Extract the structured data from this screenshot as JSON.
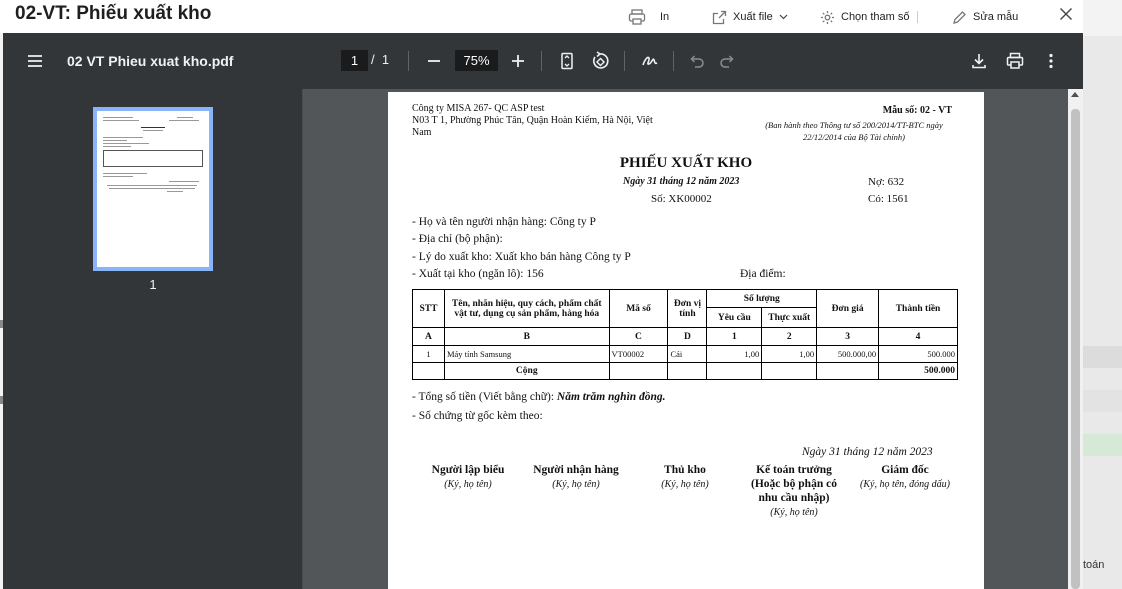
{
  "dialog": {
    "title": "02-VT: Phiếu xuất kho",
    "actions": {
      "print_label": "In",
      "export_label": "Xuất file",
      "options_label": "Chọn tham số",
      "edit_label": "Sửa mẫu"
    }
  },
  "viewer": {
    "filename": "02 VT Phieu xuat kho.pdf",
    "page_current": "1",
    "page_separator": "/",
    "page_total": "1",
    "zoom": "75%",
    "thumbnail_page_label": "1"
  },
  "background": {
    "right_edge_text": "toán"
  },
  "document": {
    "company_name": "Công ty MISA 267- QC ASP test",
    "company_address": "N03 T 1, Phường Phúc Tân, Quận Hoàn Kiếm, Hà Nội, Việt Nam",
    "form_code": "Mẫu số: 02 - VT",
    "form_note": "(Ban hành theo Thông tư số 200/2014/TT-BTC ngày 22/12/2014 của Bộ Tài chính)",
    "title": "PHIẾU XUẤT KHO",
    "date": "Ngày 31 tháng 12 năm 2023",
    "number": "Số: XK00002",
    "debit": "Nợ: 632",
    "credit": "Có: 1561",
    "receiver": "- Họ và tên người nhận hàng: Công ty P",
    "address": "- Địa chỉ (bộ phận):",
    "reason": "- Lý do xuất kho: Xuất kho bán hàng Công ty P",
    "warehouse": "- Xuất tại kho (ngăn lô): 156",
    "location": "Địa điểm:",
    "table": {
      "headers": {
        "stt": "STT",
        "name": "Tên, nhãn hiệu, quy cách, phẩm chất vật tư, dụng cụ sản phẩm, hàng hóa",
        "code": "Mã số",
        "unit": "Đơn vị tính",
        "quantity": "Số lượng",
        "qty_request": "Yêu cầu",
        "qty_actual": "Thực xuất",
        "price": "Đơn giá",
        "amount": "Thành tiền"
      },
      "letters": [
        "A",
        "B",
        "C",
        "D",
        "1",
        "2",
        "3",
        "4"
      ],
      "rows": [
        {
          "stt": "1",
          "name": "Máy tính Samsung",
          "code": "VT00002",
          "unit": "Cái",
          "qty_request": "1,00",
          "qty_actual": "1,00",
          "price": "500.000,00",
          "amount": "500.000"
        }
      ],
      "total_label": "Cộng",
      "total_amount": "500.000"
    },
    "total_in_words_label": "- Tổng số tiền (Viết bằng chữ):",
    "total_in_words": "Năm trăm nghìn đồng.",
    "attachments": "- Số chứng từ gốc kèm theo:",
    "sign_date": "Ngày 31 tháng 12 năm 2023",
    "signatures": [
      {
        "role": "Người lập biểu",
        "note": "(Ký, họ tên)"
      },
      {
        "role": "Người nhận hàng",
        "note": "(Ký, họ tên)"
      },
      {
        "role": "Thủ kho",
        "note": "(Ký, họ tên)"
      },
      {
        "role": "Kế toán trưởng (Hoặc bộ phận có nhu cầu nhập)",
        "note": "(Ký, họ tên)"
      },
      {
        "role": "Giám đốc",
        "note": "(Ký, họ tên, đóng dấu)"
      }
    ]
  }
}
